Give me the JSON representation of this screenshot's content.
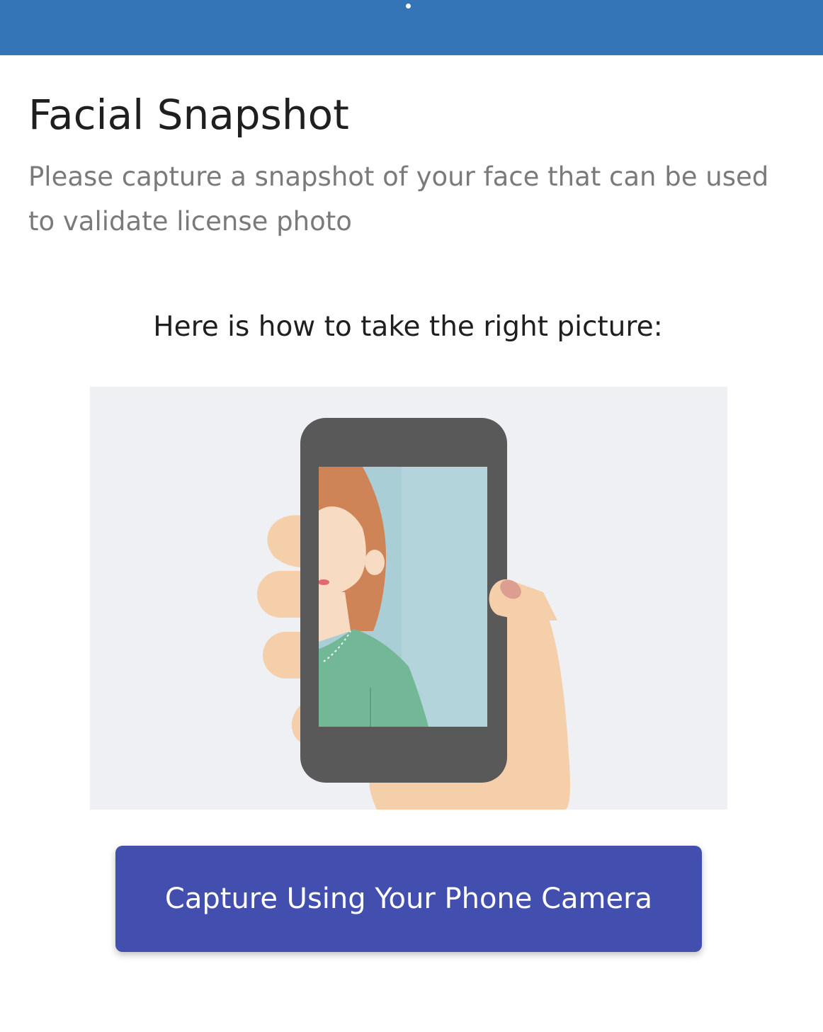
{
  "colors": {
    "topbar": "#3475b7",
    "button": "#434fae",
    "button_text": "#ffffff"
  },
  "page": {
    "title": "Facial Snapshot",
    "subtitle": "Please capture a snapshot of your face that can be used to validate license photo",
    "howto_heading": "Here is how to take the right picture:"
  },
  "illustration": {
    "icon": "hand-holding-phone-selfie-icon"
  },
  "actions": {
    "capture_label": "Capture Using Your Phone Camera"
  }
}
